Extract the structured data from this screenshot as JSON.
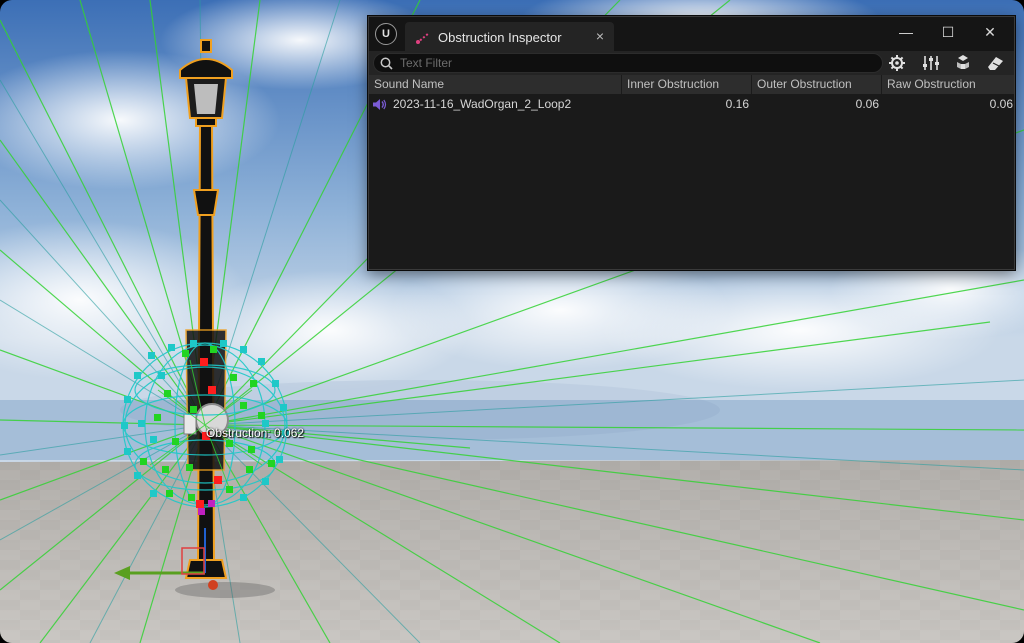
{
  "viewport": {
    "overlay_label": "Obstruction: 0.062"
  },
  "window": {
    "tab_title": "Obstruction Inspector",
    "tab_close": "×",
    "controls": {
      "minimize": "—",
      "maximize": "☐",
      "close": "✕"
    }
  },
  "toolbar": {
    "search_placeholder": "Text Filter",
    "search_value": "",
    "icons": [
      "settings-gear-icon",
      "sliders-icon",
      "cubes-icon",
      "eraser-icon"
    ]
  },
  "table": {
    "columns": [
      "Sound Name",
      "Inner Obstruction",
      "Outer Obstruction",
      "Raw Obstruction"
    ],
    "rows": [
      {
        "sound_name": "2023-11-16_WadOrgan_2_Loop2",
        "inner": "0.16",
        "outer": "0.06",
        "raw": "0.06"
      }
    ]
  },
  "colors": {
    "panel_bg": "#151515",
    "header_bg": "#2d2d2d",
    "speaker_icon": "#7b5cd6",
    "selection_outline": "#f0a020",
    "ray_green": "#3cd63c",
    "node_cyan": "#1ec8c8",
    "node_red": "#ff1e1e"
  }
}
